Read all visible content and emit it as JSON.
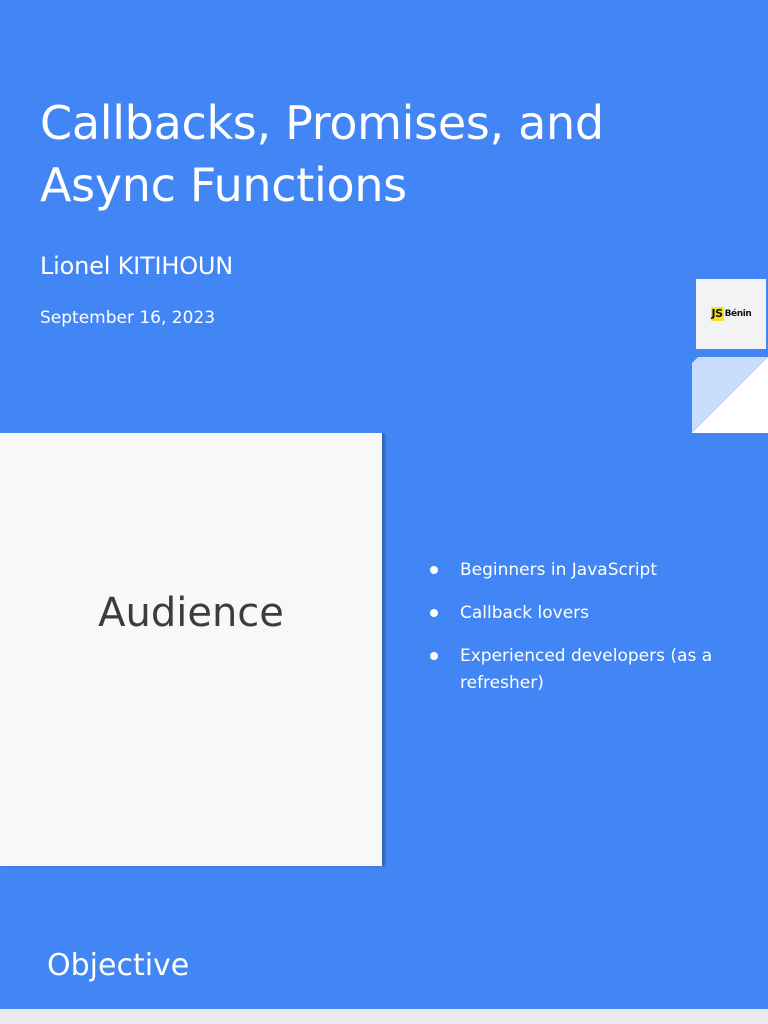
{
  "slide1": {
    "title": "Callbacks, Promises, and Async Functions",
    "author": "Lionel KITIHOUN",
    "date": "September 16, 2023",
    "logo": {
      "mark": "JS",
      "text": "Bénin"
    }
  },
  "slide2": {
    "heading": "Audience",
    "bullets": [
      "Beginners in JavaScript",
      "Callback lovers",
      "Experienced developers (as a refresher)"
    ]
  },
  "slide3": {
    "heading": "Objective"
  },
  "colors": {
    "slide_background": "#4285f4",
    "panel_background": "#f8f8f8",
    "logo_yellow": "#f7df1e",
    "text_light": "#ffffff",
    "text_dark": "#3c3c3c"
  }
}
